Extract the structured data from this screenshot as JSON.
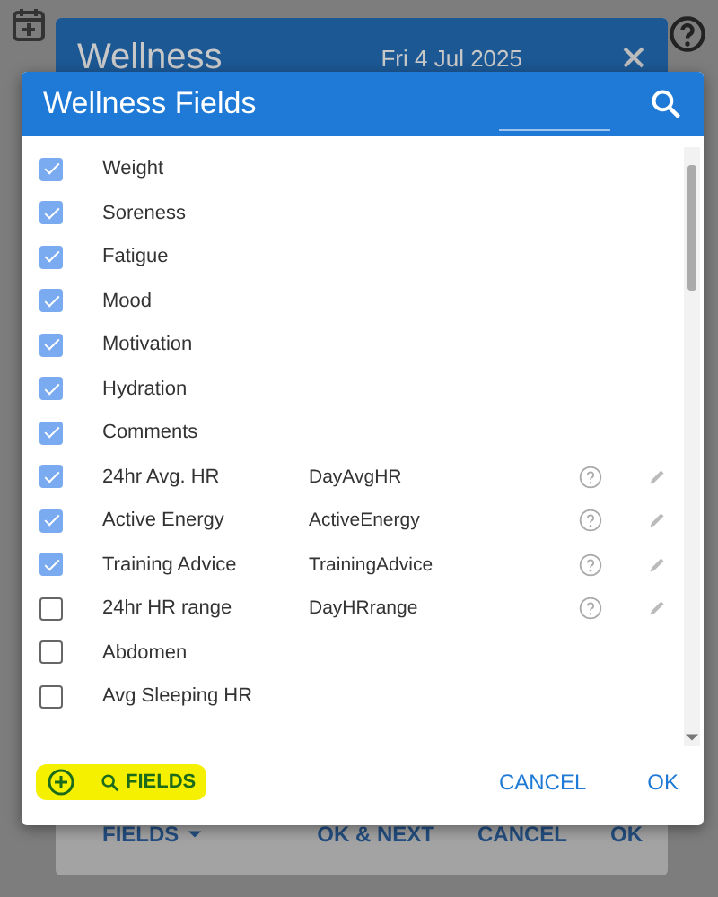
{
  "back_dialog": {
    "title": "Wellness",
    "date": "Fri 4 Jul 2025",
    "buttons": [
      {
        "label": "FIELDS",
        "kind": "menu"
      },
      {
        "label": "OK & NEXT",
        "kind": "plain"
      },
      {
        "label": "CANCEL",
        "kind": "plain"
      },
      {
        "label": "OK",
        "kind": "plain"
      }
    ]
  },
  "dialog": {
    "title": "Wellness Fields",
    "fields": [
      {
        "name": "Weight",
        "checked": true
      },
      {
        "name": "Soreness",
        "checked": true
      },
      {
        "name": "Fatigue",
        "checked": true
      },
      {
        "name": "Mood",
        "checked": true
      },
      {
        "name": "Motivation",
        "checked": true
      },
      {
        "name": "Hydration",
        "checked": true
      },
      {
        "name": "Comments",
        "checked": true
      },
      {
        "name": "24hr Avg. HR",
        "checked": true,
        "code": "DayAvgHR"
      },
      {
        "name": "Active Energy",
        "checked": true,
        "code": "ActiveEnergy"
      },
      {
        "name": "Training Advice",
        "checked": true,
        "code": "TrainingAdvice"
      },
      {
        "name": "24hr HR range",
        "checked": false,
        "code": "DayHRrange"
      },
      {
        "name": "Abdomen",
        "checked": false
      },
      {
        "name": "Avg Sleeping HR",
        "checked": false
      }
    ],
    "footer": {
      "fields_label": "FIELDS",
      "cancel": "CANCEL",
      "ok": "OK"
    }
  }
}
